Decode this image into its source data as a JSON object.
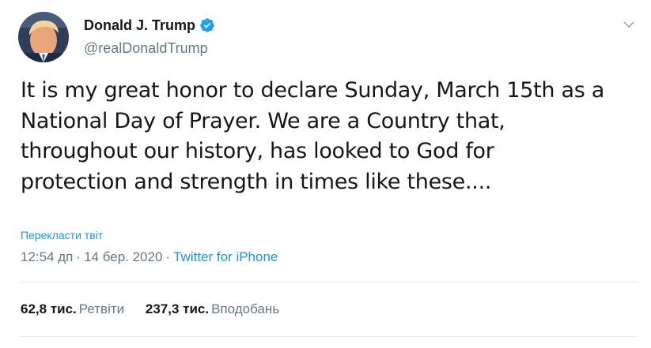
{
  "author": {
    "display_name": "Donald J. Trump",
    "handle": "@realDonaldTrump",
    "verified_icon": "verified-badge-icon",
    "avatar_icon": "profile-avatar"
  },
  "menu": {
    "caret_icon": "chevron-down-icon"
  },
  "tweet": {
    "text": "It is my great honor to declare Sunday, March 15th as a\nNational Day of Prayer. We are a Country that,\nthroughout our history, has looked to God for\nprotection and strength in times like these...."
  },
  "translate": {
    "label": "Перекласти твіт"
  },
  "meta": {
    "time": "12:54 дп",
    "separator": "·",
    "date": "14 бер. 2020",
    "source": "Twitter for iPhone"
  },
  "stats": {
    "retweets_count": "62,8 тис.",
    "retweets_label": "Ретвіти",
    "likes_count": "237,3 тис.",
    "likes_label": "Вподобань"
  },
  "colors": {
    "accent": "#1da1f2",
    "link": "#1b95e0",
    "text": "#14171a",
    "secondary": "#657786",
    "divider": "#e6ecf0"
  }
}
